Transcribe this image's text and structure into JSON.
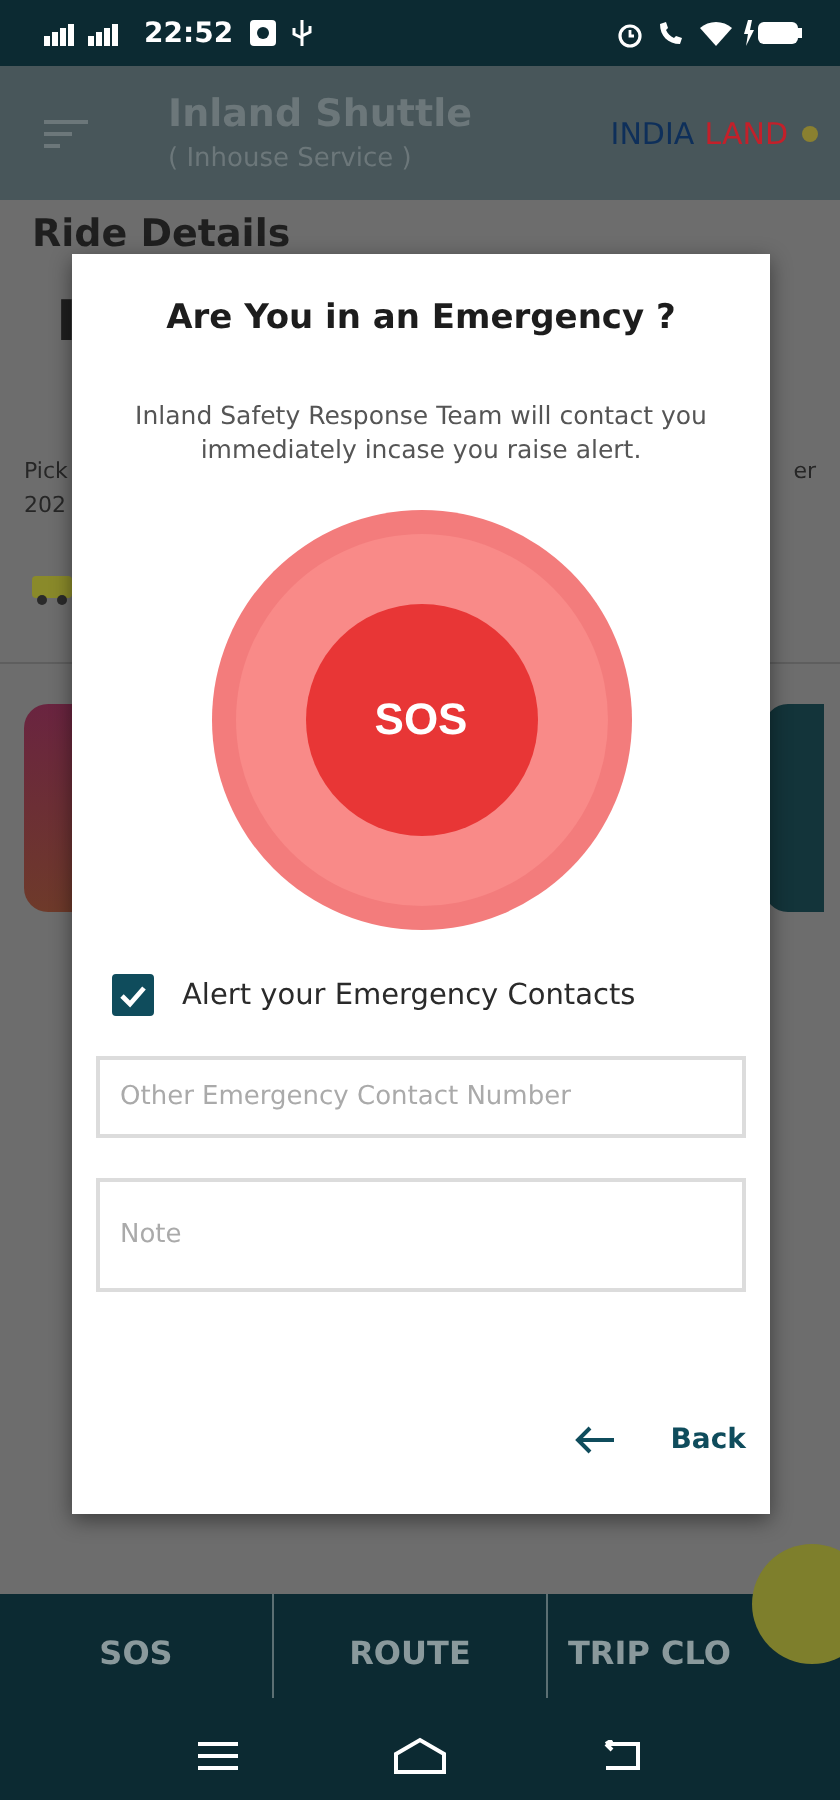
{
  "status_bar": {
    "time": "22:52"
  },
  "app_bar": {
    "title": "Inland Shuttle",
    "subtitle": "( Inhouse Service )",
    "logo": {
      "word_1": "INDIA",
      "word_2": "LAND"
    }
  },
  "background": {
    "heading": "Ride Details",
    "big_letter": "I",
    "left_texts": [
      "Pick",
      "202"
    ],
    "right_text": "er"
  },
  "dialog": {
    "title": "Are You in an Emergency ?",
    "message": "Inland Safety Response Team will contact you immediately incase you raise alert.",
    "sos_button": "SOS",
    "checkbox": {
      "label": "Alert your Emergency Contacts",
      "checked": true
    },
    "fields": [
      {
        "placeholder": "Other Emergency Contact Number"
      },
      {
        "placeholder": "Note"
      }
    ],
    "back_button": "Back"
  },
  "bottom_nav": [
    {
      "label": "SOS"
    },
    {
      "label": "ROUTE"
    },
    {
      "label": "TRIP CLO"
    }
  ]
}
